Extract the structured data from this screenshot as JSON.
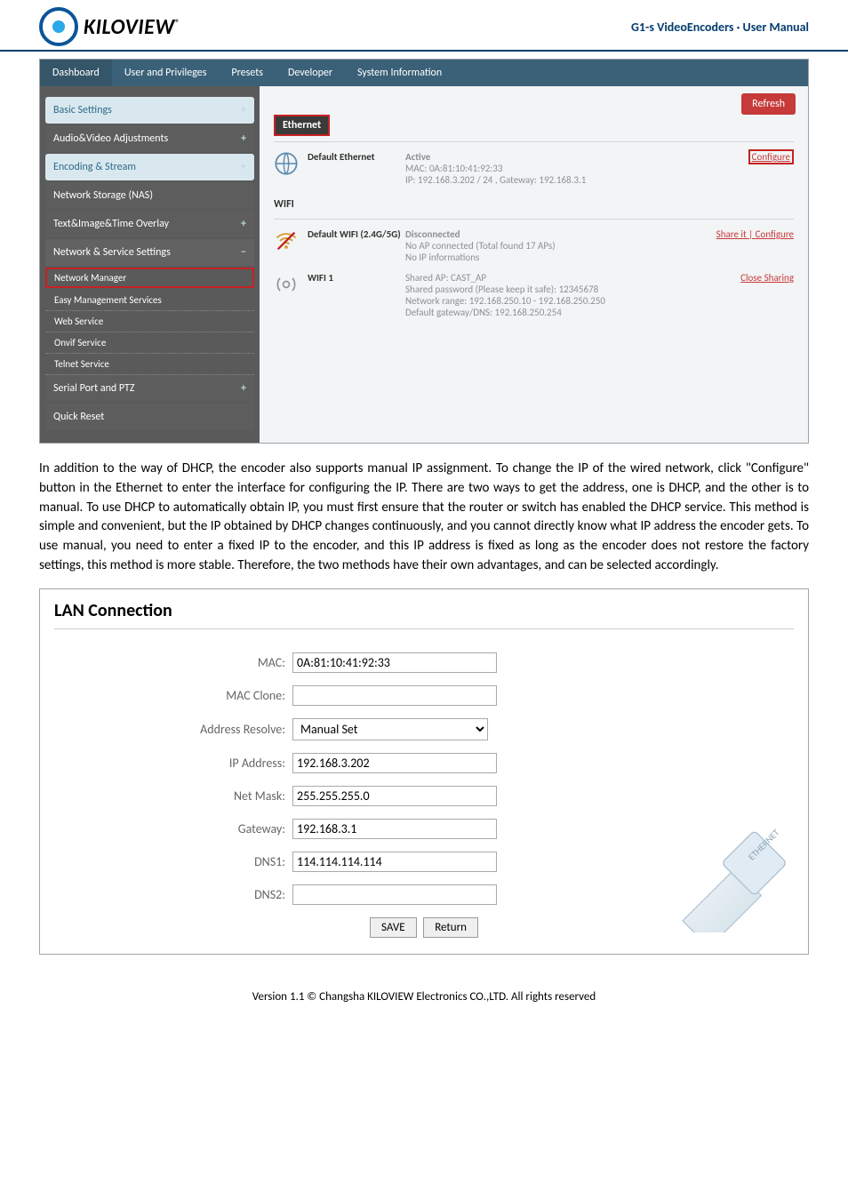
{
  "header": {
    "logo_text": "KILOVIEW",
    "logo_tm": "®",
    "title": "G1-s VideoEncoders · User Manual"
  },
  "tabs": {
    "dashboard": "Dashboard",
    "users": "User and Privileges",
    "presets": "Presets",
    "developer": "Developer",
    "sysinfo": "System Information"
  },
  "sidebar": {
    "basic": "Basic Settings",
    "av": "Audio&Video Adjustments",
    "encoding": "Encoding & Stream",
    "nas": "Network Storage (NAS)",
    "overlay": "Text&Image&Time Overlay",
    "network": "Network & Service Settings",
    "sub_netmgr": "Network Manager",
    "sub_easy": "Easy Management Services",
    "sub_web": "Web Service",
    "sub_onvif": "Onvif Service",
    "sub_telnet": "Telnet Service",
    "serial": "Serial Port and PTZ",
    "quick": "Quick Reset"
  },
  "content": {
    "refresh": "Refresh",
    "eth_label": "Ethernet",
    "wifi_label": "WIFI",
    "eth_name": "Default Ethernet",
    "eth_status": "Active",
    "eth_mac": "MAC: 0A:81:10:41:92:33",
    "eth_ip": "IP: 192.168.3.202 / 24 , Gateway: 192.168.3.1",
    "eth_action": "Configure",
    "wifi_name": "Default WIFI (2.4G/5G)",
    "wifi_status": "Disconnected",
    "wifi_note": "No AP connected (Total found 17 APs)",
    "wifi_ip": "No IP informations",
    "wifi_action": "Share it | Configure",
    "ap_name": "WIFI 1",
    "ap_line1": "Shared AP: CAST_AP",
    "ap_line2": "Shared password (Please keep it safe): 12345678",
    "ap_line3": "Network range: 192.168.250.10 - 192.168.250.250",
    "ap_line4": "Default gateway/DNS: 192.168.250.254",
    "ap_action": "Close Sharing"
  },
  "paragraph": "In addition to the way of DHCP, the encoder also supports manual IP assignment. To change the IP of the wired network, click \"Configure\" button in the Ethernet to enter the interface for configuring the IP. There are two ways to get the address, one is DHCP, and the other is to manual. To use DHCP to automatically obtain IP, you must first ensure that the router or switch has enabled the DHCP service. This method is simple and convenient, but the IP obtained by DHCP changes continuously, and you cannot directly know what IP address the encoder gets. To use manual, you need to enter a fixed IP to the encoder, and this IP address is fixed as long as the encoder does not restore the factory settings, this method is more stable. Therefore, the two methods have their own advantages, and can be selected accordingly.",
  "form": {
    "title": "LAN Connection",
    "mac_label": "MAC:",
    "mac": "0A:81:10:41:92:33",
    "macclone_label": "MAC Clone:",
    "macclone": "",
    "resolve_label": "Address Resolve:",
    "resolve": "Manual Set",
    "ip_label": "IP Address:",
    "ip": "192.168.3.202",
    "mask_label": "Net Mask:",
    "mask": "255.255.255.0",
    "gw_label": "Gateway:",
    "gw": "192.168.3.1",
    "dns1_label": "DNS1:",
    "dns1": "114.114.114.114",
    "dns2_label": "DNS2:",
    "dns2": "",
    "save": "SAVE",
    "return": "Return"
  },
  "footer": "Version 1.1 © Changsha KILOVIEW Electronics CO.,LTD. All rights reserved"
}
